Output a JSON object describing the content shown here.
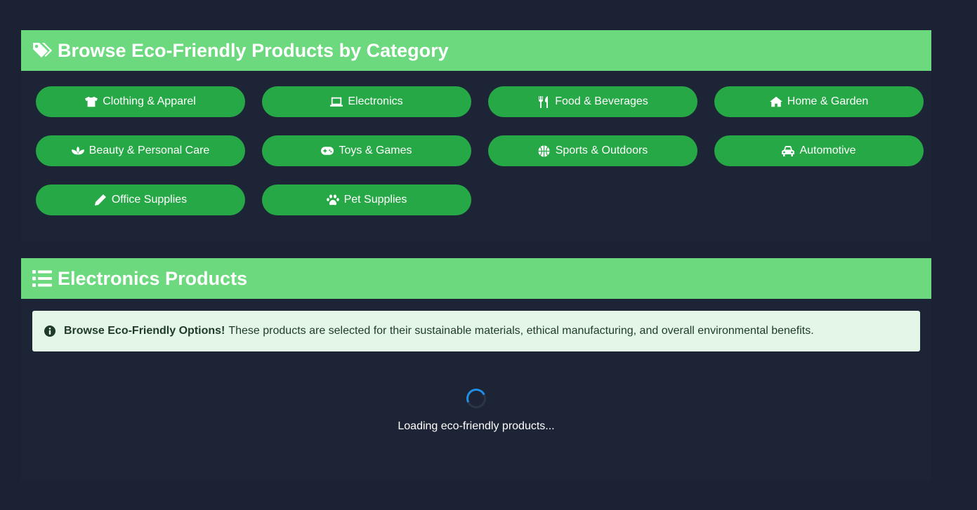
{
  "categories_section": {
    "title": "Browse Eco-Friendly Products by Category",
    "icon": "tags-icon",
    "items": [
      {
        "label": "Clothing & Apparel",
        "icon": "tshirt-icon"
      },
      {
        "label": "Electronics",
        "icon": "laptop-icon"
      },
      {
        "label": "Food & Beverages",
        "icon": "utensils-icon"
      },
      {
        "label": "Home & Garden",
        "icon": "home-icon"
      },
      {
        "label": "Beauty & Personal Care",
        "icon": "spa-icon"
      },
      {
        "label": "Toys & Games",
        "icon": "gamepad-icon"
      },
      {
        "label": "Sports & Outdoors",
        "icon": "basketball-icon"
      },
      {
        "label": "Automotive",
        "icon": "car-icon"
      },
      {
        "label": "Office Supplies",
        "icon": "pencil-icon"
      },
      {
        "label": "Pet Supplies",
        "icon": "paw-icon"
      }
    ]
  },
  "products_section": {
    "title": "Electronics Products",
    "icon": "list-icon",
    "alert": {
      "strong": "Browse Eco-Friendly Options!",
      "text": "These products are selected for their sustainable materials, ethical manufacturing, and overall environmental benefits.",
      "icon": "info-circle-icon"
    },
    "loading_text": "Loading eco-friendly products..."
  },
  "colors": {
    "header": "#6cd97e",
    "button": "#27a846",
    "background": "#1b2233",
    "alert_bg": "#e4f6e7",
    "spinner": "#1f8fe8"
  }
}
